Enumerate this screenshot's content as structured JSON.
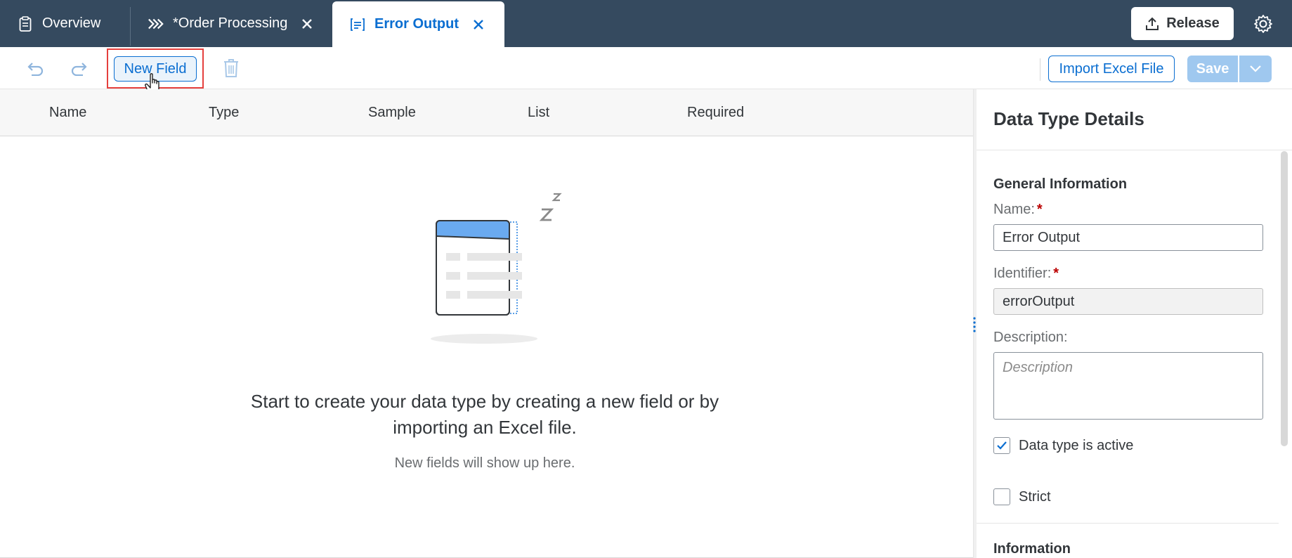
{
  "tabs": {
    "overview": "Overview",
    "order_processing": "*Order Processing",
    "error_output": "Error Output"
  },
  "header": {
    "release_label": "Release"
  },
  "toolbar": {
    "new_field_label": "New Field",
    "import_label": "Import Excel File",
    "save_label": "Save"
  },
  "table": {
    "columns": [
      "Name",
      "Type",
      "Sample",
      "List",
      "Required"
    ]
  },
  "empty_state": {
    "title": "Start to create your data type by creating a new field or by importing an Excel file.",
    "subtitle": "New fields will show up here."
  },
  "details": {
    "title": "Data Type Details",
    "general_section": "General Information",
    "name_label": "Name:",
    "name_value": "Error Output",
    "identifier_label": "Identifier:",
    "identifier_value": "errorOutput",
    "description_label": "Description:",
    "description_placeholder": "Description",
    "active_label": "Data type is active",
    "active_checked": true,
    "strict_label": "Strict",
    "strict_checked": false,
    "information_section": "Information"
  },
  "colors": {
    "shell": "#354a5f",
    "accent": "#0a6ed1",
    "required": "#bb0000",
    "highlight": "#e5403d"
  }
}
